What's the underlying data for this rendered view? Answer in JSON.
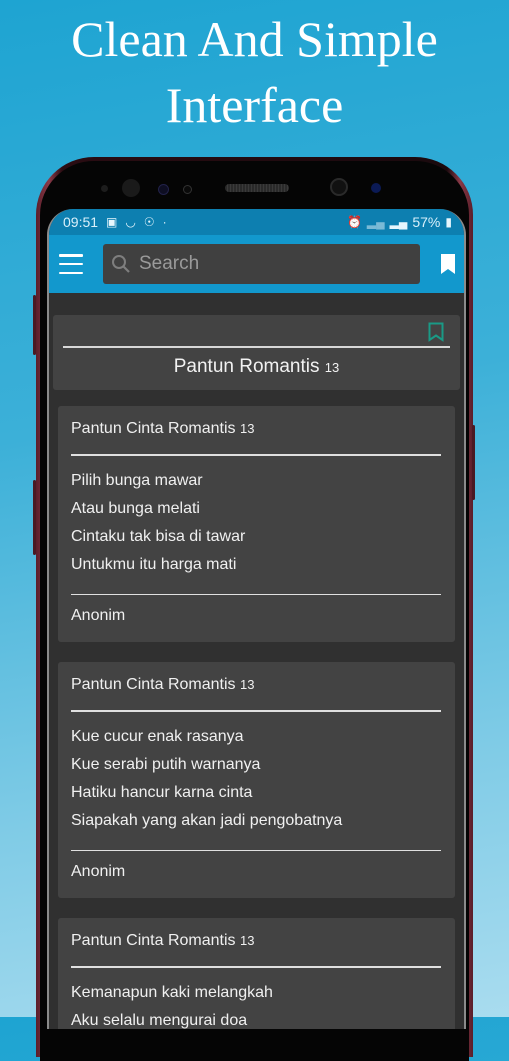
{
  "headline": {
    "line1": "Clean And Simple",
    "line2": "Interface"
  },
  "status_bar": {
    "time": "09:51",
    "left_icons": [
      "gallery-icon",
      "cloud-icon",
      "shield-icon",
      "dot-icon"
    ],
    "right_icons": [
      "alarm-icon",
      "signal-weak-icon",
      "signal-icon",
      "battery-charging-icon"
    ],
    "battery": "57%"
  },
  "app_bar": {
    "menu_icon": "hamburger-menu-icon",
    "search_placeholder": "Search",
    "bookmark_icon": "bookmark-filled-icon"
  },
  "header_card": {
    "title": "Pantun Romantis",
    "number": "13",
    "bookmark_icon": "bookmark-outline-icon",
    "accent_color": "#1a9a86"
  },
  "poems": [
    {
      "title": "Pantun Cinta Romantis",
      "number": "13",
      "lines": [
        "Pilih bunga mawar",
        "Atau bunga melati",
        "Cintaku tak bisa di tawar",
        "Untukmu itu harga mati"
      ],
      "author": "Anonim"
    },
    {
      "title": "Pantun Cinta Romantis",
      "number": "13",
      "lines": [
        "Kue cucur enak rasanya",
        "Kue serabi putih warnanya",
        "Hatiku hancur karna cinta",
        "Siapakah yang akan jadi pengobatnya"
      ],
      "author": "Anonim"
    },
    {
      "title": "Pantun Cinta Romantis",
      "number": "13",
      "lines": [
        "Kemanapun kaki melangkah",
        "Aku selalu mengurai doa"
      ],
      "author": ""
    }
  ],
  "colors": {
    "app_bar": "#1298cd",
    "status_bar": "#0d7fb0",
    "background": "#303030",
    "card": "#434343"
  }
}
